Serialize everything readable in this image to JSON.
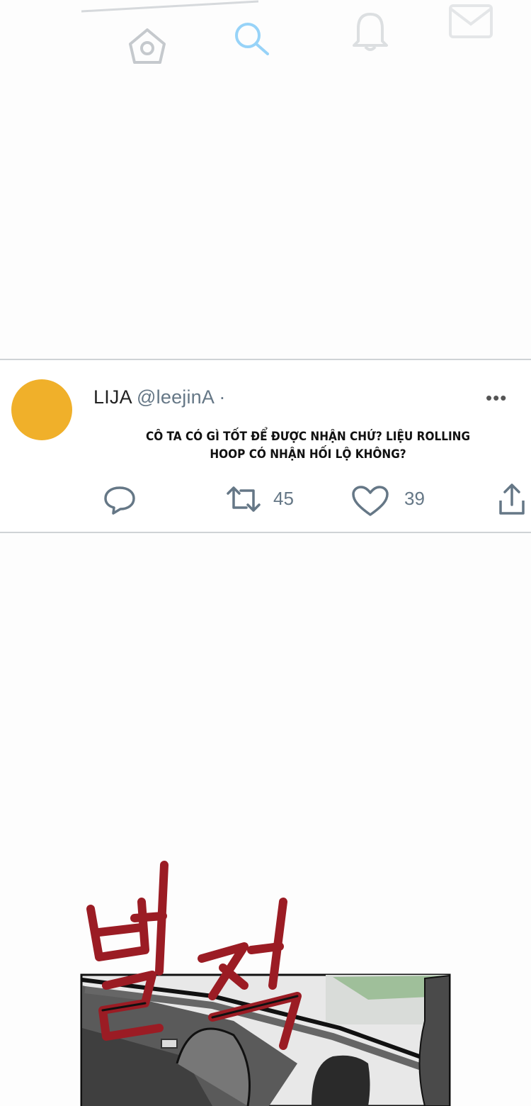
{
  "nav": {
    "icons": [
      "home-icon",
      "search-icon",
      "bell-icon",
      "mail-icon"
    ],
    "accent": "#1da1f2"
  },
  "tweet": {
    "avatar_color": "#f0b02a",
    "name": "LIJA",
    "handle": "@leejinA ·",
    "more": "•••",
    "text": "CÔ TA CÓ GÌ TỐT ĐỂ ĐƯỢC NHẬN CHỨ? LIỆU ROLLING HOOP CÓ NHẬN HỐI LỘ KHÔNG?",
    "retweets": "45",
    "likes": "39",
    "icons": [
      "reply-icon",
      "retweet-icon",
      "heart-icon",
      "share-icon"
    ]
  },
  "comic": {
    "sfx_color": "#9b1c24"
  }
}
